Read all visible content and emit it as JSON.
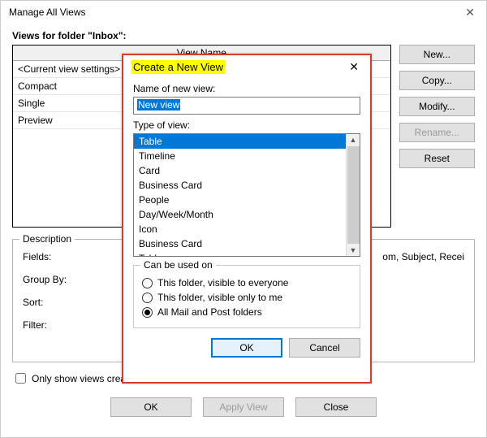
{
  "outer": {
    "title": "Manage All Views",
    "views_for_label": "Views for folder \"Inbox\":",
    "table_header": "View Name",
    "rows": [
      "<Current view settings>",
      "Compact",
      "Single",
      "Preview"
    ],
    "buttons": {
      "new": "New...",
      "copy": "Copy...",
      "modify": "Modify...",
      "rename": "Rename...",
      "reset": "Reset"
    },
    "description": {
      "legend": "Description",
      "fields_label": "Fields:",
      "fields_value": "om, Subject, Recei",
      "groupby_label": "Group By:",
      "sort_label": "Sort:",
      "filter_label": "Filter:"
    },
    "only_show_label": "Only show views created for this folder",
    "bottom": {
      "ok": "OK",
      "apply": "Apply View",
      "close": "Close"
    }
  },
  "modal": {
    "title": "Create a New View",
    "name_label": "Name of new view:",
    "name_value": "New view",
    "type_label": "Type of view:",
    "type_options": [
      "Table",
      "Timeline",
      "Card",
      "Business Card",
      "People",
      "Day/Week/Month",
      "Icon",
      "Business Card",
      "Table"
    ],
    "type_selected_index": 0,
    "used_on": {
      "legend": "Can be used on",
      "options": [
        "This folder, visible to everyone",
        "This folder, visible only to me",
        "All Mail and Post folders"
      ],
      "selected_index": 2
    },
    "buttons": {
      "ok": "OK",
      "cancel": "Cancel"
    }
  }
}
